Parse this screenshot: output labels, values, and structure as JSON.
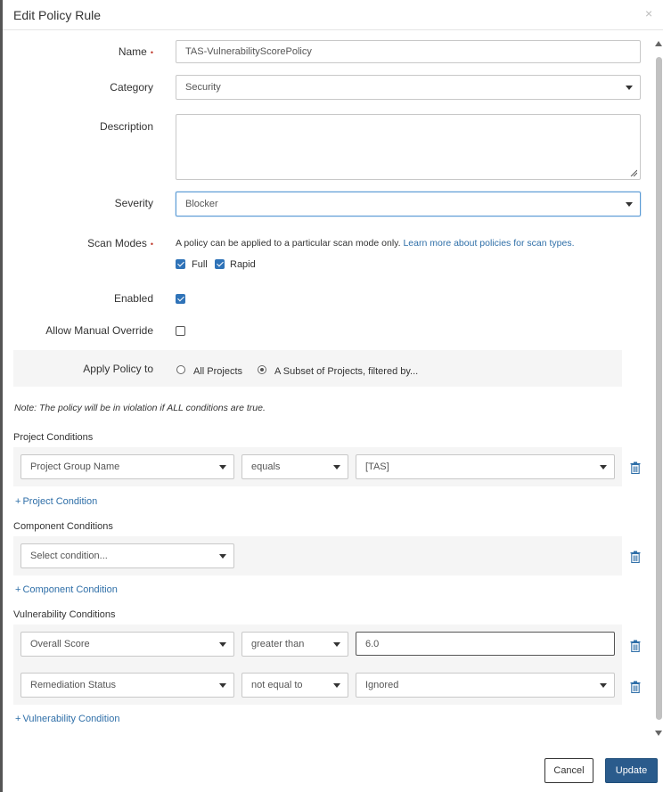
{
  "dialog": {
    "title": "Edit Policy Rule",
    "close_symbol": "×"
  },
  "form": {
    "name_label": "Name",
    "name_value": "TAS-VulnerabilityScorePolicy",
    "required_mark": "•",
    "category_label": "Category",
    "category_value": "Security",
    "description_label": "Description",
    "description_value": "",
    "severity_label": "Severity",
    "severity_value": "Blocker",
    "scan_modes_label": "Scan Modes",
    "scan_modes_help": "A policy can be applied to a particular scan mode only.",
    "scan_modes_link": "Learn more about policies for scan types.",
    "scan_full_label": "Full",
    "scan_full_checked": true,
    "scan_rapid_label": "Rapid",
    "scan_rapid_checked": true,
    "enabled_label": "Enabled",
    "enabled_checked": true,
    "override_label": "Allow Manual Override",
    "override_checked": false,
    "apply_label": "Apply Policy to",
    "apply_all_label": "All Projects",
    "apply_subset_label": "A Subset of Projects, filtered by...",
    "apply_selected": "subset"
  },
  "note": "Note: The policy will be in violation if ALL conditions are true.",
  "project_conditions": {
    "title": "Project Conditions",
    "rows": [
      {
        "field": "Project Group Name",
        "operator": "equals",
        "value": "[TAS]"
      }
    ],
    "add_label": "Project Condition"
  },
  "component_conditions": {
    "title": "Component Conditions",
    "placeholder": "Select condition...",
    "add_label": "Component Condition"
  },
  "vulnerability_conditions": {
    "title": "Vulnerability Conditions",
    "rows": [
      {
        "field": "Overall Score",
        "operator": "greater than",
        "value": "6.0"
      },
      {
        "field": "Remediation Status",
        "operator": "not equal to",
        "value": "Ignored"
      }
    ],
    "add_label": "Vulnerability Condition"
  },
  "footer": {
    "cancel_label": "Cancel",
    "update_label": "Update"
  },
  "colors": {
    "accent": "#2f73b8",
    "link": "#2f6fa8",
    "primary_button": "#2a5b8c",
    "required": "#c0392b",
    "panel": "#f5f5f5"
  }
}
